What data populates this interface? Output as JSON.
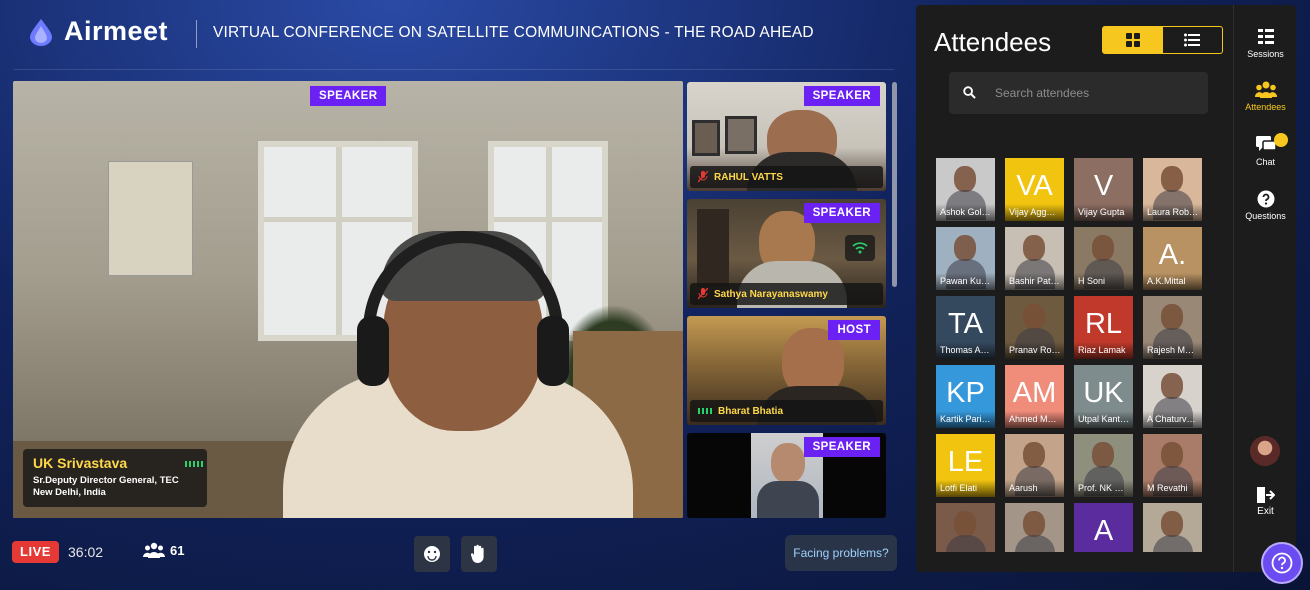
{
  "brand": {
    "name": "Airmeet"
  },
  "event": {
    "title": "VIRTUAL CONFERENCE ON SATELLITE COMMUINCATIONS - THE ROAD AHEAD"
  },
  "main_stage": {
    "badge": "SPEAKER",
    "speaker_name": "UK Srivastava",
    "speaker_title": "Sr.Deputy Director General, TEC",
    "speaker_location": "New Delhi, India"
  },
  "side_tiles": [
    {
      "badge": "SPEAKER",
      "name": "RAHUL VATTS",
      "mic": "mic-off-icon"
    },
    {
      "badge": "SPEAKER",
      "name": "Sathya Narayanaswamy",
      "mic": "mic-off-icon"
    },
    {
      "badge": "HOST",
      "name": "Bharat Bhatia",
      "mic": "audio-level-icon"
    },
    {
      "badge": "SPEAKER",
      "name": "",
      "mic": ""
    }
  ],
  "bottom_bar": {
    "live_label": "LIVE",
    "timer": "36:02",
    "participant_count": "61",
    "help_button": "Facing problems?"
  },
  "attendees_panel": {
    "title": "Attendees",
    "search_placeholder": "Search attendees",
    "view_modes": [
      "grid-view-icon",
      "list-view-icon"
    ],
    "active_view": "grid-view-icon",
    "attendees": [
      {
        "name": "Ashok Gol…",
        "initials": "",
        "color": "#c9c9c9"
      },
      {
        "name": "Vijay Agg…",
        "initials": "VA",
        "color": "#f1c40f"
      },
      {
        "name": "Vijay Gupta",
        "initials": "V",
        "color": "#8d6e63"
      },
      {
        "name": "Laura Rob…",
        "initials": "",
        "color": "#d9b79a"
      },
      {
        "name": "Pawan Ku…",
        "initials": "",
        "color": "#9fb0c0"
      },
      {
        "name": "Bashir Pat…",
        "initials": "",
        "color": "#c8bfb4"
      },
      {
        "name": "H Soni",
        "initials": "",
        "color": "#8a7a64"
      },
      {
        "name": "A.K.Mittal",
        "initials": "A.",
        "color": "#b89262"
      },
      {
        "name": "Thomas A…",
        "initials": "TA",
        "color": "#34495e"
      },
      {
        "name": "Pranav Ro…",
        "initials": "",
        "color": "#6d5a3f"
      },
      {
        "name": "Riaz Lamak",
        "initials": "RL",
        "color": "#c0392b"
      },
      {
        "name": "Rajesh M…",
        "initials": "",
        "color": "#9a8877"
      },
      {
        "name": "Kartik Pari…",
        "initials": "KP",
        "color": "#3498db"
      },
      {
        "name": "Ahmed M…",
        "initials": "AM",
        "color": "#f08c7a"
      },
      {
        "name": "Utpal Kant…",
        "initials": "UK",
        "color": "#7f8c8d"
      },
      {
        "name": "A Chaturv…",
        "initials": "",
        "color": "#d7d2cc"
      },
      {
        "name": "Lotfi Elati",
        "initials": "LE",
        "color": "#f1c40f"
      },
      {
        "name": "Aarush",
        "initials": "",
        "color": "#c3a48b"
      },
      {
        "name": "Prof. NK …",
        "initials": "",
        "color": "#8f8f7e"
      },
      {
        "name": "M Revathi",
        "initials": "",
        "color": "#a97c69"
      },
      {
        "name": "",
        "initials": "",
        "color": "#7a5a48"
      },
      {
        "name": "",
        "initials": "",
        "color": "#a39588"
      },
      {
        "name": "",
        "initials": "A",
        "color": "#5b2c9e"
      },
      {
        "name": "",
        "initials": "",
        "color": "#b4a897"
      }
    ]
  },
  "rail": {
    "items": [
      {
        "label": "Sessions",
        "icon": "sessions-icon"
      },
      {
        "label": "Attendees",
        "icon": "attendees-icon",
        "active": true
      },
      {
        "label": "Chat",
        "icon": "chat-icon"
      },
      {
        "label": "Questions",
        "icon": "questions-icon"
      }
    ],
    "exit_label": "Exit"
  },
  "colors": {
    "accent_yellow": "#f6c71e",
    "badge_purple": "#6b21f3",
    "live_red": "#e53935",
    "help_purple": "#6b4cf0"
  }
}
